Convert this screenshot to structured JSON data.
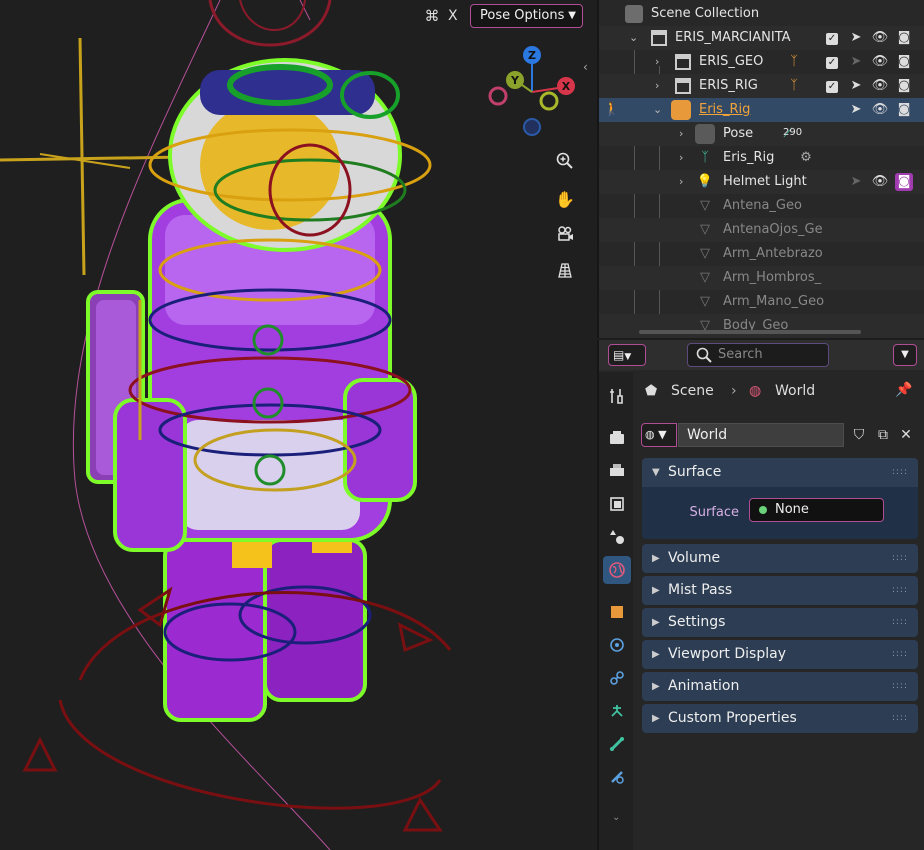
{
  "viewport": {
    "header": {
      "x_label": "X",
      "pose_options_label": "Pose Options"
    },
    "gizmo": {
      "axis_x": "X",
      "axis_y": "Y",
      "axis_z": "Z"
    },
    "tools": [
      "zoom-icon",
      "hand-pan-icon",
      "camera-view-icon",
      "grid-ortho-icon"
    ]
  },
  "outliner": {
    "scene_collection": "Scene Collection",
    "rows": [
      {
        "label": "ERIS_MARCIANITA"
      },
      {
        "label": "ERIS_GEO"
      },
      {
        "label": "ERIS_RIG"
      },
      {
        "label": "Eris_Rig"
      },
      {
        "label": "Pose",
        "badge": "290"
      },
      {
        "label": "Eris_Rig"
      },
      {
        "label": "Helmet Light"
      },
      {
        "label": "Antena_Geo"
      },
      {
        "label": "AntenaOjos_Ge"
      },
      {
        "label": "Arm_Antebrazo"
      },
      {
        "label": "Arm_Hombros_"
      },
      {
        "label": "Arm_Mano_Geo"
      },
      {
        "label": "Body_Geo"
      }
    ]
  },
  "properties": {
    "search_placeholder": "Search",
    "breadcrumb": {
      "scene": "Scene",
      "world": "World"
    },
    "world_name": "World",
    "panels": {
      "surface": "Surface",
      "volume": "Volume",
      "mist_pass": "Mist Pass",
      "settings": "Settings",
      "viewport_display": "Viewport Display",
      "animation": "Animation",
      "custom_properties": "Custom Properties"
    },
    "surface_field": {
      "label": "Surface",
      "value": "None"
    },
    "colors": {
      "accent": "#b04d95",
      "panel_header": "#2d3e54",
      "panel_body": "#1f3047",
      "active_tab": "#2f5780"
    }
  }
}
